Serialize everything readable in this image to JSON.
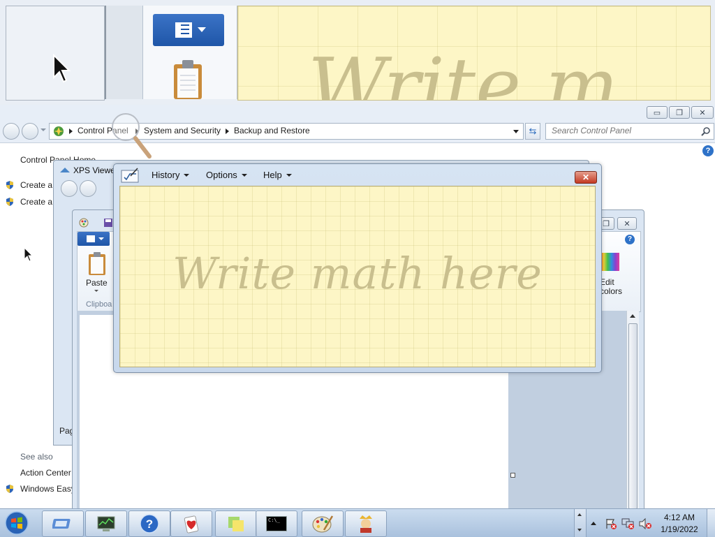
{
  "magnifier": {
    "paper_text": "Write m"
  },
  "control_panel": {
    "breadcrumb": [
      "Control Panel",
      "System and Security",
      "Backup and Restore"
    ],
    "search_placeholder": "Search Control Panel",
    "sidebar": {
      "home_link": "Control Panel Home",
      "links": [
        "Create a",
        "Create a"
      ],
      "see_also_header": "See also",
      "see_also": [
        "Action Center",
        "Windows Easy"
      ]
    }
  },
  "xps_viewer": {
    "title": "XPS Viewer",
    "status": "Pag"
  },
  "paint": {
    "paste_label": "Paste",
    "clipboard_label": "Clipboa",
    "edit_colors_label": "Edit colors"
  },
  "math_input": {
    "menus": [
      "History",
      "Options",
      "Help"
    ],
    "placeholder": "Write math here",
    "close": "✕"
  },
  "taskbar": {
    "time": "4:12 AM",
    "date": "1/19/2022",
    "cmd_label": "C:\\_"
  }
}
